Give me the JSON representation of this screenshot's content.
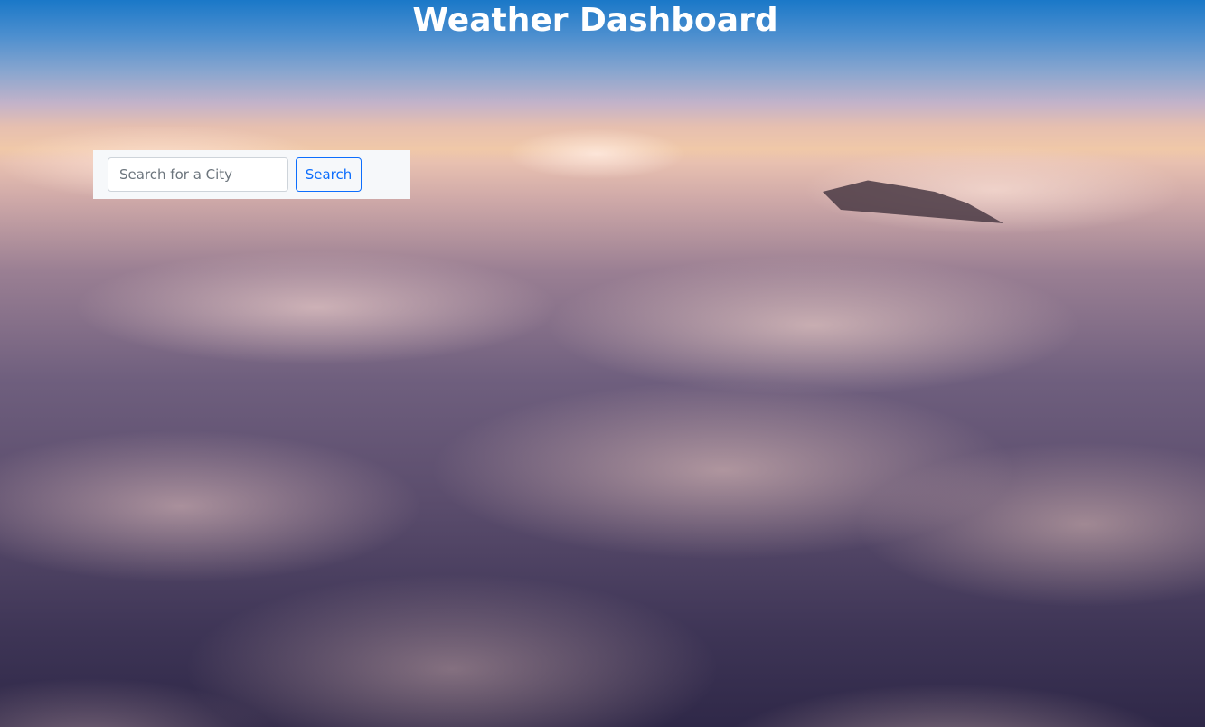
{
  "header": {
    "title": "Weather Dashboard"
  },
  "search": {
    "placeholder": "Search for a City",
    "value": "",
    "button_label": "Search"
  },
  "colors": {
    "title_text": "#ffffff",
    "button_accent": "#0d6efd",
    "panel_background": "#f6f8fa"
  }
}
